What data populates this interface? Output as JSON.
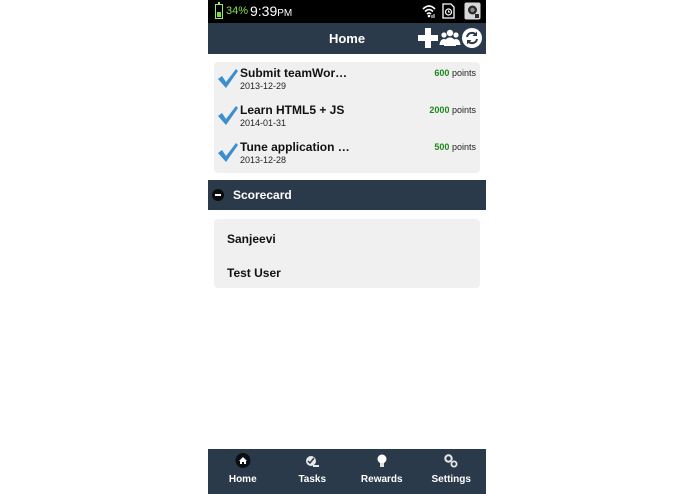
{
  "status_bar": {
    "battery_percent": "34%",
    "time": "9:39",
    "ampm": "PM"
  },
  "header": {
    "title": "Home",
    "actions": [
      "add-icon",
      "team-icon",
      "refresh-icon"
    ]
  },
  "tasks": [
    {
      "title": "Submit teamWor…",
      "date": "2013-12-29",
      "points": "600",
      "points_label": "points",
      "completed": true
    },
    {
      "title": "Learn HTML5 + JS",
      "date": "2014-01-31",
      "points": "2000",
      "points_label": "points",
      "completed": true
    },
    {
      "title": "Tune application …",
      "date": "2013-12-28",
      "points": "500",
      "points_label": "points",
      "completed": true
    }
  ],
  "scorecard": {
    "title": "Scorecard",
    "members": [
      "Sanjeevi",
      "Test User"
    ]
  },
  "tabbar": {
    "tabs": [
      {
        "label": "Home",
        "icon": "home-icon"
      },
      {
        "label": "Tasks",
        "icon": "tasks-icon"
      },
      {
        "label": "Rewards",
        "icon": "rewards-icon"
      },
      {
        "label": "Settings",
        "icon": "settings-icon"
      }
    ]
  },
  "colors": {
    "navbar": "#2b3a4a",
    "card": "#f0f0f0",
    "points_green": "#1a8a1a",
    "check_blue": "#3a8fd0",
    "battery_green": "#8be04e"
  }
}
